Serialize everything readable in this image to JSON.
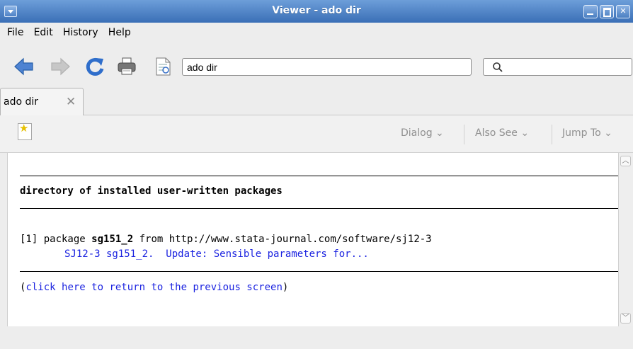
{
  "window": {
    "title": "Viewer - ado dir"
  },
  "menus": [
    "File",
    "Edit",
    "History",
    "Help"
  ],
  "address": {
    "value": "ado dir"
  },
  "tabs": [
    {
      "label": "ado dir"
    }
  ],
  "viewer_menus": [
    "Dialog",
    "Also See",
    "Jump To"
  ],
  "content": {
    "heading": "directory of installed user-written packages",
    "item_prefix": "[1] package ",
    "package_name": "sg151_2",
    "item_from": " from http://www.stata-journal.com/software/sj12-3",
    "package_link": "SJ12-3 sg151_2.  Update: Sensible parameters for...",
    "back_open": "(",
    "back_link": "click here to return to the previous screen",
    "back_close": ")"
  },
  "colors": {
    "titlebar": "#4a7dc1",
    "link": "#1b23e0"
  },
  "icons": [
    "back-arrow-icon",
    "forward-arrow-icon",
    "refresh-icon",
    "print-icon",
    "document-icon",
    "search-icon",
    "new-viewer-icon",
    "close-icon"
  ]
}
